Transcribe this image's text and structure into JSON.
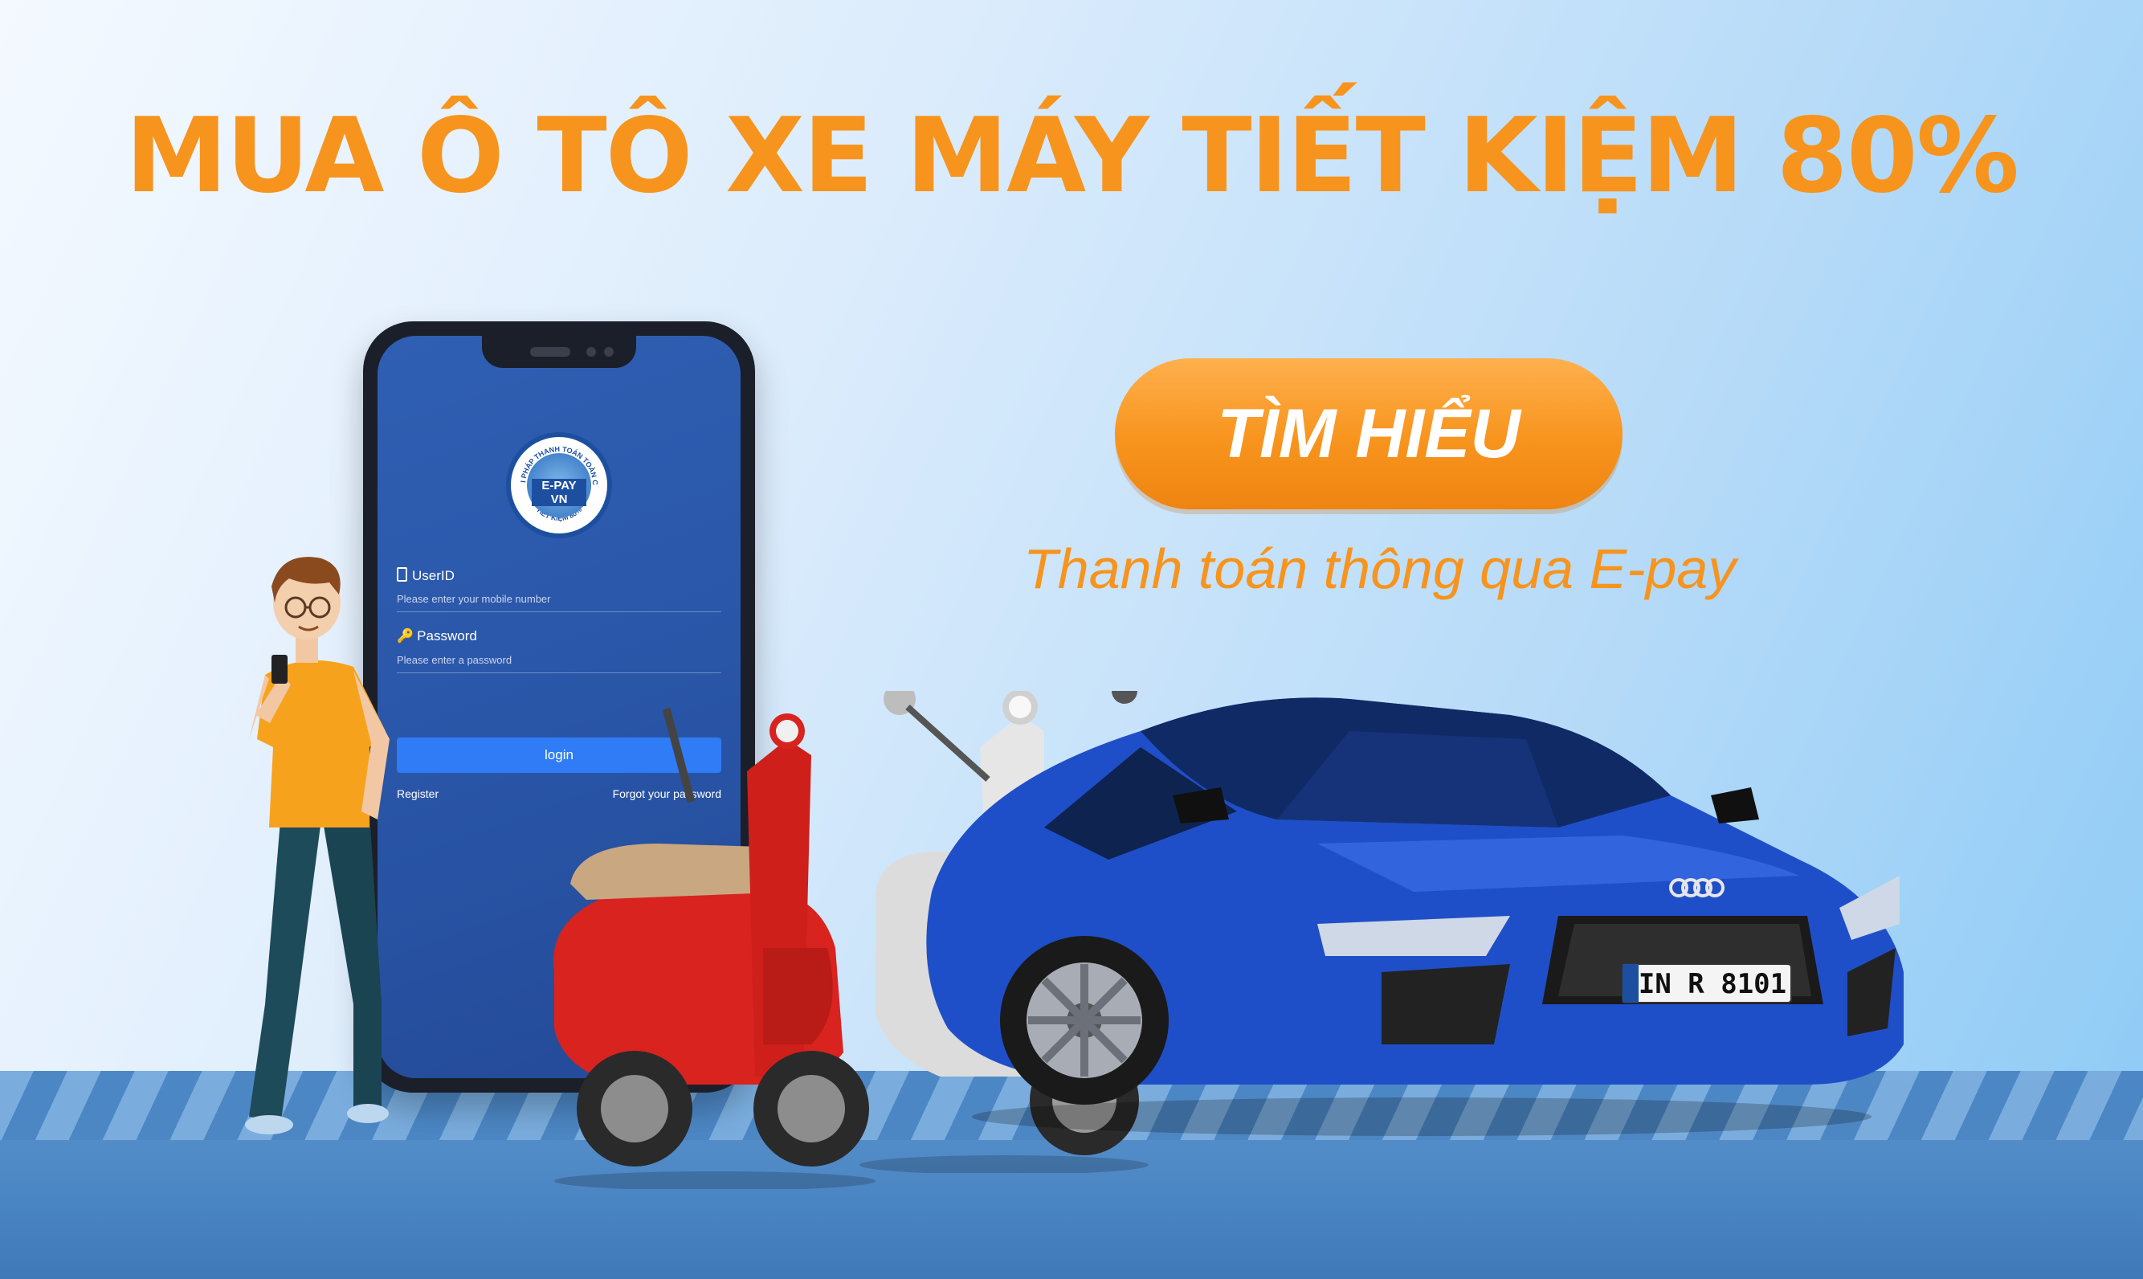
{
  "banner": {
    "headline": "MUA Ô TÔ XE MÁY TIẾT KIỆM 80%",
    "cta_label": "TÌM HIỂU",
    "tagline": "Thanh toán thông qua E-pay"
  },
  "phone_app": {
    "logo_text": "E-PAY VN",
    "logo_ring_top": "GIẢI PHÁP THANH TOÁN TOÀN CẦU",
    "logo_ring_bottom": "TIẾT KIỆM 80%",
    "userid_label": "UserID",
    "userid_placeholder": "Please enter your mobile number",
    "password_label": "Password",
    "password_placeholder": "Please enter a password",
    "login_label": "login",
    "register_label": "Register",
    "forgot_label": "Forgot your password"
  },
  "car": {
    "plate": "IN R 8101"
  },
  "colors": {
    "accent_orange": "#f7941d",
    "app_blue": "#2a56a8",
    "car_blue": "#1f4fc8",
    "scooter_red": "#d8231f",
    "floor_blue": "#4b86c4"
  }
}
